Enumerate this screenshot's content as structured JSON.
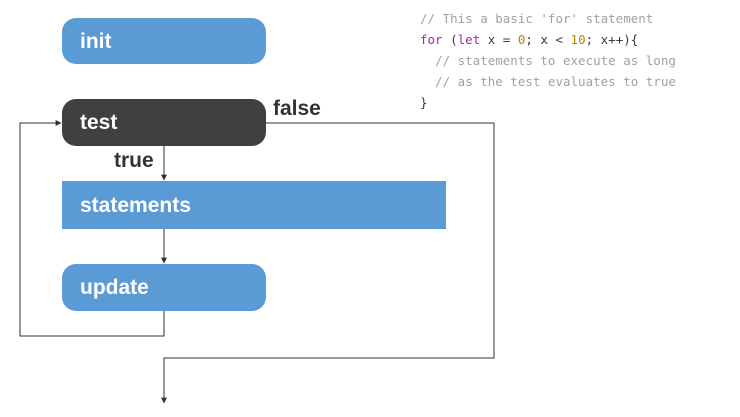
{
  "nodes": {
    "init": "init",
    "test": "test",
    "statements": "statements",
    "update": "update"
  },
  "edges": {
    "false_label": "false",
    "true_label": "true"
  },
  "code": {
    "line1": "// This a basic 'for' statement",
    "line2_kw_for": "for",
    "line2_open": " (",
    "line2_kw_let": "let",
    "line2_a": " x = ",
    "line2_num0": "0",
    "line2_b": "; x < ",
    "line2_num10": "10",
    "line2_c": "; x++){",
    "line3": "  // statements to execute as long",
    "line4": "  // as the test evaluates to true",
    "line5": "}"
  },
  "colors": {
    "box_blue": "#5b9bd5",
    "box_dark": "#404040",
    "connector": "#333333",
    "comment": "#a0a1a7",
    "keyword": "#a626a4",
    "number": "#c18401"
  }
}
